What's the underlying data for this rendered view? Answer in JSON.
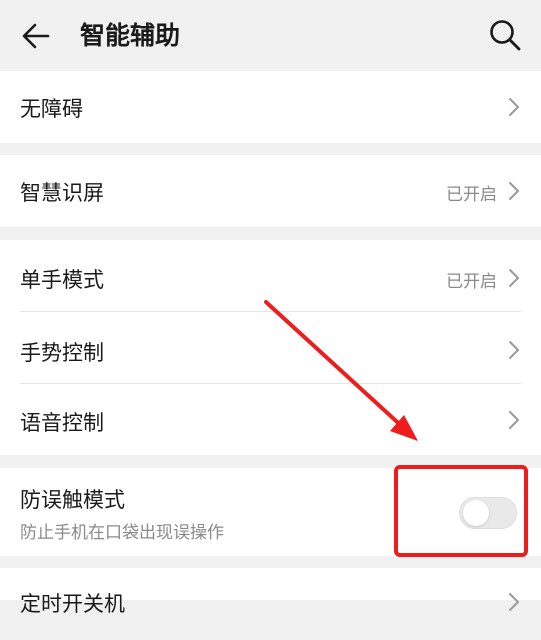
{
  "header": {
    "title": "智能辅助",
    "back_icon": "arrow-left-icon",
    "search_icon": "search-icon"
  },
  "sections": [
    {
      "items": [
        {
          "label": "无障碍",
          "status": "",
          "icon": "chevron-right-icon"
        }
      ]
    },
    {
      "items": [
        {
          "label": "智慧识屏",
          "status": "已开启",
          "icon": "chevron-right-icon"
        }
      ]
    },
    {
      "items": [
        {
          "label": "单手模式",
          "status": "已开启",
          "icon": "chevron-right-icon"
        },
        {
          "label": "手势控制",
          "status": "",
          "icon": "chevron-right-icon"
        },
        {
          "label": "语音控制",
          "status": "",
          "icon": "chevron-right-icon"
        }
      ]
    },
    {
      "items": [
        {
          "label": "防误触模式",
          "subtitle": "防止手机在口袋出现误操作",
          "toggle_on": false
        }
      ]
    },
    {
      "items": [
        {
          "label": "定时开关机",
          "status": "",
          "icon": "chevron-right-icon"
        }
      ]
    }
  ],
  "annotation": {
    "color": "#ee1c1c",
    "target": "toggle"
  },
  "colors": {
    "background": "#f1f1f1",
    "card": "#ffffff",
    "primary_text": "#1a1a1a",
    "secondary_text": "#8a8a8a",
    "annotation": "#ee1c1c"
  }
}
